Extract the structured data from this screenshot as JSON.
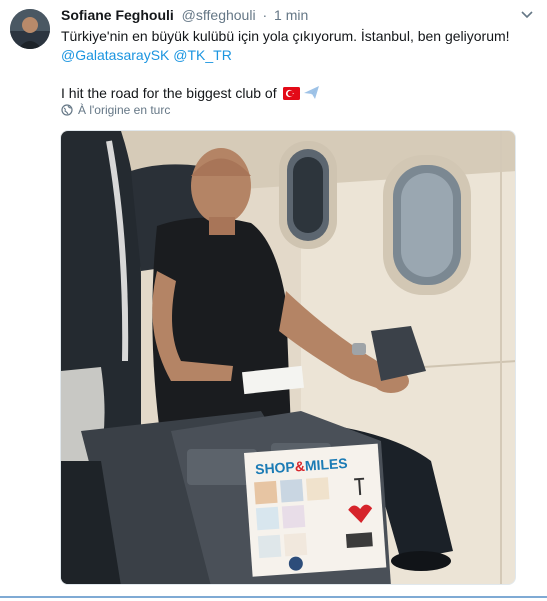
{
  "author": {
    "name": "Sofiane Feghouli",
    "handle": "@sffeghouli",
    "separator": "·",
    "time": "1 min"
  },
  "tweet": {
    "line1": "Türkiye'nin en büyük kulübü için yola çıkıyorum. İstanbul, ben geliyorum!",
    "mention1": "@GalatasaraySK",
    "mention2": "@TK_TR",
    "line3": "I hit the road for the biggest club of",
    "emoji1": "turkey-flag-icon",
    "emoji2": "airplane-icon"
  },
  "translate": {
    "label": "À l'origine en turc"
  },
  "media": {
    "magazine_title_left": "SHOP",
    "magazine_title_amp": "&",
    "magazine_title_right": "MILES"
  },
  "colors": {
    "link": "#1b95e0",
    "muted": "#657786",
    "text": "#14171a"
  }
}
